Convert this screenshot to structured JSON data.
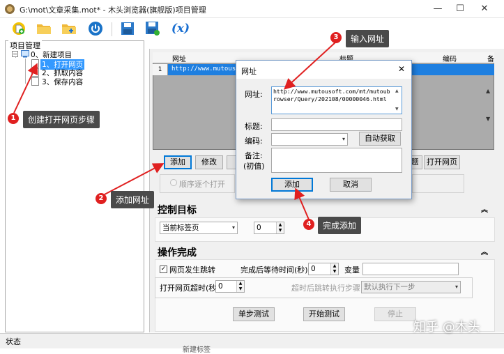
{
  "window": {
    "title": "G:\\mot\\文章采集.mot* - 木头浏览器(旗舰版)项目管理",
    "min_glyph": "—",
    "max_glyph": "☐",
    "close_glyph": "✕"
  },
  "toolbar": {
    "icons": [
      "new-project-icon",
      "open-folder-icon",
      "add-folder-icon",
      "power-icon",
      "save-icon",
      "save-as-icon",
      "variable-icon"
    ],
    "variable_label": "(x)"
  },
  "left_panel": {
    "group_title": "项目管理",
    "tree": [
      {
        "label": "0、新建项目",
        "level": 0
      },
      {
        "label": "1、打开网页",
        "level": 1,
        "selected": true
      },
      {
        "label": "2、抓取内容",
        "level": 1
      },
      {
        "label": "3、保存内容",
        "level": 1
      }
    ]
  },
  "grid": {
    "columns": [
      "网址",
      "标题",
      "编码",
      "备"
    ],
    "rows": [
      {
        "num": "1",
        "url": "http://www.mutouso"
      }
    ]
  },
  "buttons_row": {
    "add": "添加",
    "edit": "修改",
    "partial": "题",
    "open_page": "打开网页"
  },
  "radio_order": "顺序逐个打开",
  "sections": {
    "control_target": {
      "title": "控制目标",
      "tab_select": "当前标签页",
      "spin_value": "0"
    },
    "operation_done": {
      "title": "操作完成",
      "redirect_checkbox_label": "网页发生跳转",
      "redirect_checked": true,
      "wait_label": "完成后等待时间(秒)",
      "wait_value": "0",
      "variable_label": "变量",
      "timeout_label": "打开网页超时(秒)",
      "timeout_value": "0",
      "after_redirect_label": "超时后跳转执行步骤:",
      "after_redirect_value": "默认执行下一步"
    }
  },
  "bottom_buttons": {
    "single_test": "单步测试",
    "start_test": "开始测试",
    "stop": "停止"
  },
  "statusbar": {
    "text": "状态",
    "tail_text": "新建标签"
  },
  "dialog": {
    "title": "网址",
    "url_label": "网址:",
    "url_value": "http://www.mutousoft.com/mt/mutoubrowser/Query/202108/00000046.html",
    "title_label": "标题:",
    "title_value": "",
    "encoding_label": "编码:",
    "encoding_value": "",
    "auto_detect": "自动获取",
    "note_label": "备注:",
    "note_label2": "(初值)",
    "note_value": "",
    "add_button": "添加",
    "cancel_button": "取消"
  },
  "annotations": [
    {
      "num": "1",
      "text": "创建打开网页步骤"
    },
    {
      "num": "2",
      "text": "添加网址"
    },
    {
      "num": "3",
      "text": "输入网址"
    },
    {
      "num": "4",
      "text": "完成添加"
    }
  ],
  "watermark": "知乎 @木头",
  "colors": {
    "selection": "#3399ff",
    "annotation_badge": "#e02020",
    "annotation_bg": "#4a4a4a",
    "focus_border": "#0078d7"
  }
}
